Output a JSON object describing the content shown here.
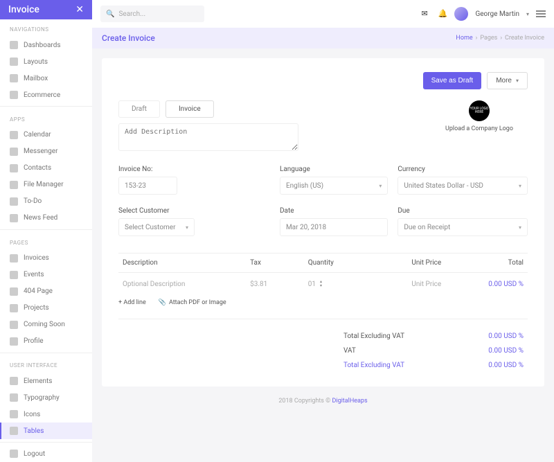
{
  "brand": "Invoice",
  "search": {
    "placeholder": "Search..."
  },
  "user": {
    "name": "George Martin"
  },
  "sidebar": {
    "sections": [
      {
        "label": "NAVIGATIONS",
        "items": [
          {
            "label": "Dashboards"
          },
          {
            "label": "Layouts"
          },
          {
            "label": "Mailbox"
          },
          {
            "label": "Ecommerce"
          }
        ]
      },
      {
        "label": "APPS",
        "items": [
          {
            "label": "Calendar"
          },
          {
            "label": "Messenger"
          },
          {
            "label": "Contacts"
          },
          {
            "label": "File Manager"
          },
          {
            "label": "To-Do"
          },
          {
            "label": "News Feed"
          }
        ]
      },
      {
        "label": "PAGES",
        "items": [
          {
            "label": "Invoices"
          },
          {
            "label": "Events"
          },
          {
            "label": "404 Page"
          },
          {
            "label": "Projects"
          },
          {
            "label": "Coming Soon"
          },
          {
            "label": "Profile"
          }
        ]
      },
      {
        "label": "USER INTERFACE",
        "items": [
          {
            "label": "Elements"
          },
          {
            "label": "Typography"
          },
          {
            "label": "Icons"
          },
          {
            "label": "Tables",
            "active": true
          }
        ]
      }
    ],
    "logout": "Logout"
  },
  "page": {
    "title": "Create Invoice",
    "breadcrumb": {
      "home": "Home",
      "mid": "Pages",
      "current": "Create Invoice"
    }
  },
  "actions": {
    "save": "Save as Draft",
    "more": "More"
  },
  "tabs": {
    "draft": "Draft",
    "invoice": "Invoice"
  },
  "form": {
    "description_placeholder": "Add Description",
    "logo_text": "YOUR LOGO HERE",
    "upload_label": "Upload a Company Logo",
    "invoice_no": {
      "label": "Invoice No:",
      "value": "153-23"
    },
    "language": {
      "label": "Language",
      "value": "English (US)"
    },
    "currency": {
      "label": "Currency",
      "value": "United States Dollar - USD"
    },
    "customer": {
      "label": "Select Customer",
      "value": "Select Customer"
    },
    "date": {
      "label": "Date",
      "value": "Mar 20, 2018"
    },
    "due": {
      "label": "Due",
      "value": "Due on Receipt"
    }
  },
  "line_items": {
    "headers": {
      "desc": "Description",
      "tax": "Tax",
      "qty": "Quantity",
      "unit": "Unit Price",
      "total": "Total"
    },
    "rows": [
      {
        "desc": "Optional Description",
        "tax": "$3.81",
        "qty": "01",
        "unit": "Unit Price",
        "total": "0.00 USD %"
      }
    ],
    "add_line": "+ Add line",
    "attach": "Attach PDF or Image"
  },
  "totals": {
    "excl_vat": {
      "label": "Total Excluding VAT",
      "value": "0.00 USD %"
    },
    "vat": {
      "label": "VAT",
      "value": "0.00 USD %"
    },
    "final": {
      "label": "Total Excluding VAT",
      "value": "0.00 USD %"
    }
  },
  "footer": {
    "text": "2018 Copyrights © ",
    "link": "DigitalHeaps"
  }
}
